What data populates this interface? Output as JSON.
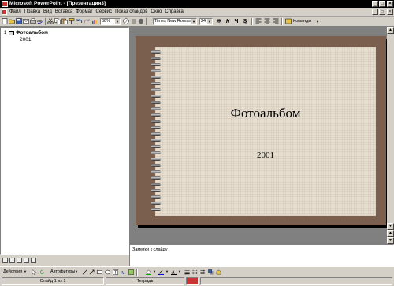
{
  "window": {
    "title": "Microsoft PowerPoint - [Презентация3]",
    "controls": [
      "_",
      "□",
      "×"
    ]
  },
  "menu": {
    "items": [
      "Файл",
      "Правка",
      "Вид",
      "Вставка",
      "Формат",
      "Сервис",
      "Показ слайдов",
      "Окно",
      "Справка"
    ],
    "doc_controls": [
      "_",
      "□",
      "×"
    ]
  },
  "toolbar": {
    "zoom": "68%",
    "font": "Times New Roman",
    "font_size": "24",
    "bold": "Ж",
    "italic": "К",
    "underline": "Ч",
    "shadow": "S",
    "commands_label": "Команды"
  },
  "outline": {
    "slide_number": "1",
    "title": "Фотоальбом",
    "subtitle": "2001"
  },
  "slide": {
    "title": "Фотоальбом",
    "subtitle": "2001",
    "frame_color": "#7a5e4e",
    "paper_color": "#e6ddce"
  },
  "notes": {
    "placeholder": "Заметки к слайду"
  },
  "drawing": {
    "actions_label": "Действия",
    "autoshapes_label": "Автофигуры"
  },
  "status": {
    "slide": "Слайд 1 из 1",
    "design": "Тетрадь"
  }
}
